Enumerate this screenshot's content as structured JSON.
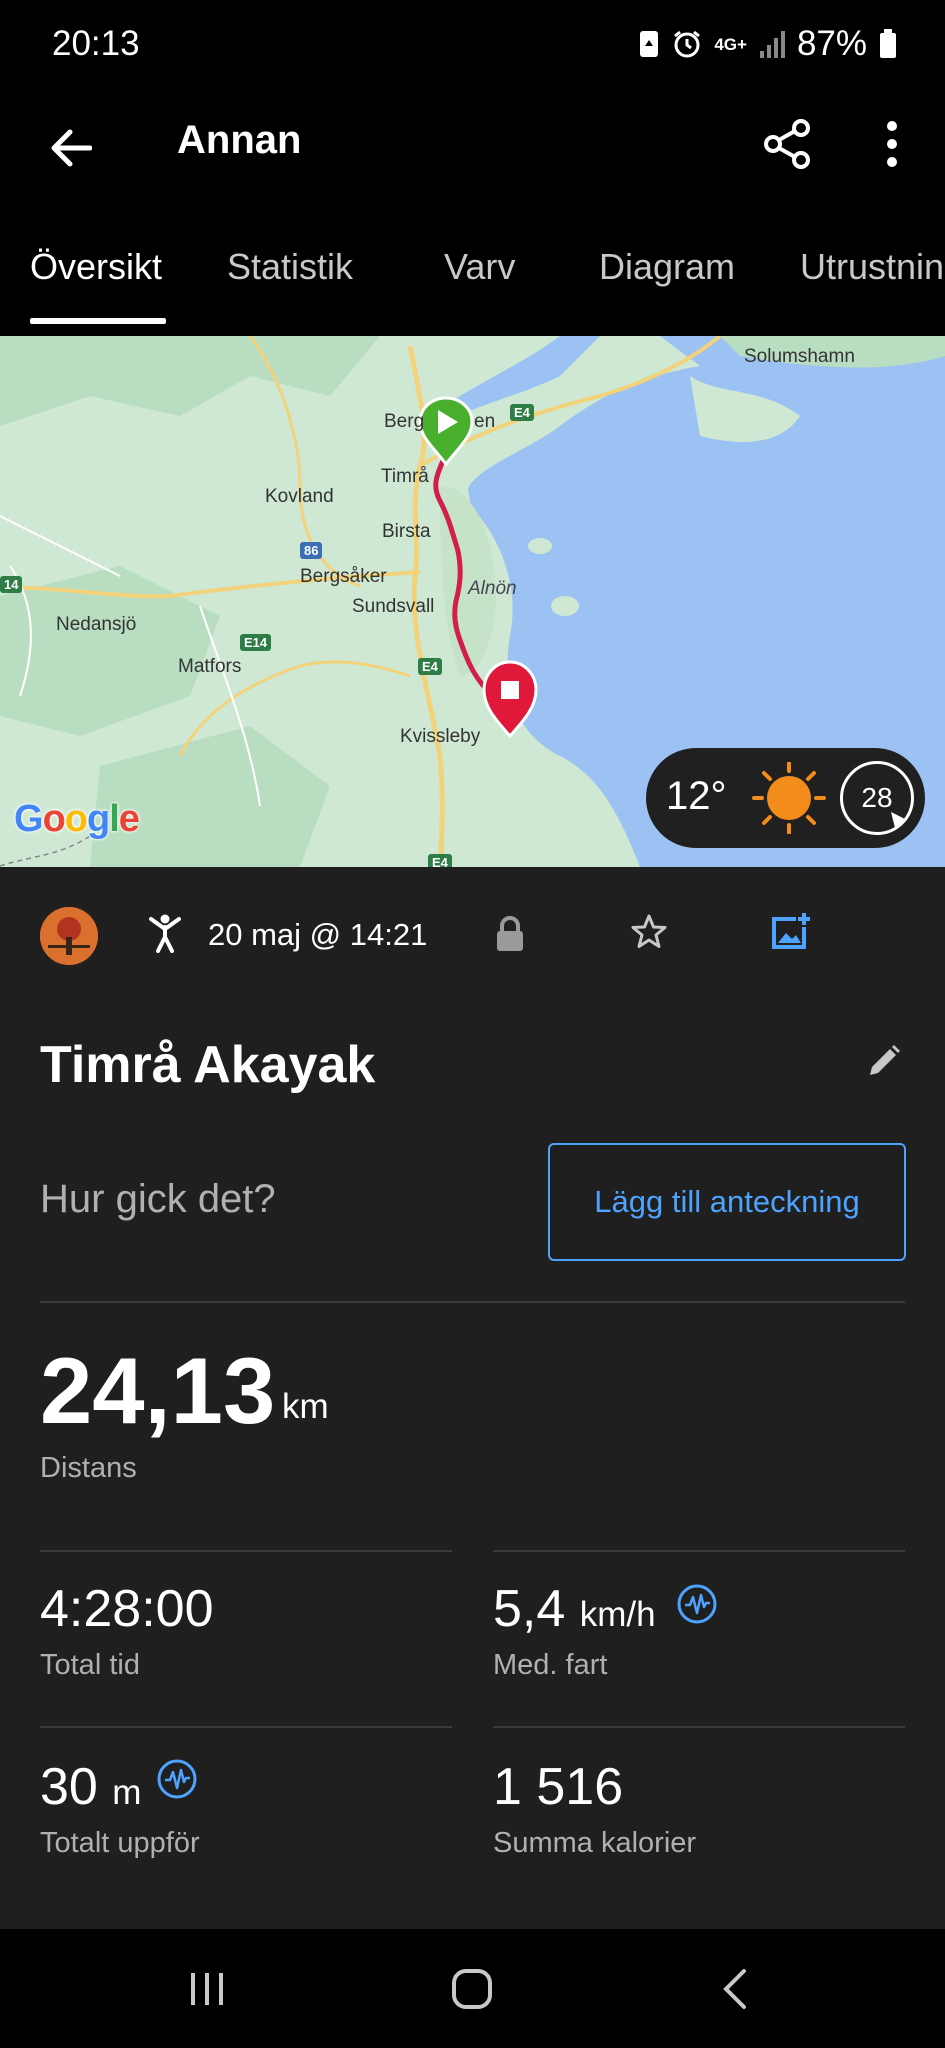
{
  "status_bar": {
    "time": "20:13",
    "network": "4G+",
    "battery": "87%"
  },
  "app_bar": {
    "title": "Annan"
  },
  "tabs": [
    {
      "label": "Översikt",
      "active": true
    },
    {
      "label": "Statistik",
      "active": false
    },
    {
      "label": "Varv",
      "active": false
    },
    {
      "label": "Diagram",
      "active": false
    },
    {
      "label": "Utrustning",
      "active": false
    }
  ],
  "map": {
    "places": {
      "solumshamn": "Solumshamn",
      "bergeforsen_a": "Berg",
      "bergeforsen_b": "en",
      "timra": "Timrå",
      "kovland": "Kovland",
      "birsta": "Birsta",
      "bergsaker": "Bergsåker",
      "sundsvall": "Sundsvall",
      "alnon": "Alnön",
      "nedansjo": "Nedansjö",
      "matfors": "Matfors",
      "kvissleby": "Kvissleby"
    },
    "roads": {
      "e4_north": "E4",
      "r86": "86",
      "e14_left": "14",
      "e14": "E14",
      "e4_mid": "E4",
      "e4_south": "E4"
    },
    "google": [
      "G",
      "o",
      "o",
      "g",
      "l",
      "e"
    ],
    "google_colors": [
      "#4285F4",
      "#EA4335",
      "#FBBC05",
      "#4285F4",
      "#34A853",
      "#EA4335"
    ],
    "weather": {
      "temperature": "12°",
      "wind": "28"
    },
    "colors": {
      "route": "#d21f4a",
      "start": "#48b02c",
      "end": "#e0183a",
      "water": "#9cc1f3"
    }
  },
  "activity": {
    "date": "20 maj @ 14:21",
    "name": "Timrå Akayak",
    "prompt": "Hur gick det?",
    "note_button": "Lägg till anteckning"
  },
  "stats": {
    "distance": {
      "value": "24,13",
      "unit": "km",
      "label": "Distans"
    },
    "total_time": {
      "value": "4:28:00",
      "label": "Total tid"
    },
    "avg_speed": {
      "value": "5,4",
      "unit": "km/h",
      "label": "Med. fart"
    },
    "ascent": {
      "value": "30",
      "unit": "m",
      "label": "Totalt uppför"
    },
    "calories": {
      "value": "1 516",
      "label": "Summa kalorier"
    }
  },
  "accent_color": "#4ea3ff"
}
